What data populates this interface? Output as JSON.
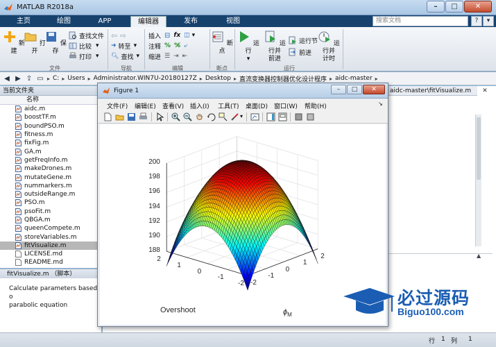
{
  "window": {
    "title": "MATLAB R2018a"
  },
  "tabs": [
    {
      "label": "主页"
    },
    {
      "label": "绘图"
    },
    {
      "label": "APP"
    },
    {
      "label": "编辑器"
    },
    {
      "label": "发布"
    },
    {
      "label": "视图"
    }
  ],
  "search": {
    "placeholder": "搜索文档"
  },
  "ribbon": {
    "file": {
      "new": "新建",
      "open": "打开",
      "save": "保存",
      "find_files": "查找文件",
      "compare": "比较",
      "print": "打印",
      "group": "文件"
    },
    "navigate": {
      "goto": "转至",
      "find": "查找",
      "group": "导航"
    },
    "edit": {
      "insert": "插入",
      "comment": "注释",
      "indent": "缩进",
      "fx": "fx",
      "group": "编辑"
    },
    "breakpoints": {
      "label": "断点",
      "group": "断点"
    },
    "run": {
      "run": "运行",
      "run_advance_1": "运行并",
      "run_advance_2": "前进",
      "run_section": "运行节",
      "advance": "前进",
      "run_time_1": "运行并",
      "run_time_2": "计时",
      "group": "运行"
    }
  },
  "addressbar": {
    "crumbs": [
      "C:",
      "Users",
      "Administrator.WIN7U-20180127Z",
      "Desktop",
      "直流变换器控制器优化设计程序",
      "aidc-master"
    ]
  },
  "folder_panel": {
    "title": "当前文件夹",
    "column": "名称",
    "files": [
      {
        "name": "aidc.m"
      },
      {
        "name": "boostTF.m"
      },
      {
        "name": "boundPSO.m"
      },
      {
        "name": "fitness.m"
      },
      {
        "name": "fixFig.m"
      },
      {
        "name": "GA.m"
      },
      {
        "name": "getFreqInfo.m"
      },
      {
        "name": "makeDrones.m"
      },
      {
        "name": "mutateGene.m"
      },
      {
        "name": "nummarkers.m"
      },
      {
        "name": "outsideRange.m"
      },
      {
        "name": "PSO.m"
      },
      {
        "name": "psoFit.m"
      },
      {
        "name": "QBGA.m"
      },
      {
        "name": "queenCompete.m"
      },
      {
        "name": "storeVariables.m"
      },
      {
        "name": "fitVisualize.m"
      },
      {
        "name": "LICENSE.md"
      },
      {
        "name": "README.md"
      }
    ],
    "selected_index": 16
  },
  "details": {
    "header": "fitVisualize.m （脚本）",
    "line1": "Calculate parameters based o",
    "line2": "parabolic equation"
  },
  "editor": {
    "tab": "aidc-master\\fitVisualize.m"
  },
  "statusbar": {
    "row_label": "行",
    "row": "1",
    "col_label": "列",
    "col": "1"
  },
  "figure": {
    "title": "Figure 1",
    "menus": [
      "文件(F)",
      "编辑(E)",
      "查看(V)",
      "插入(I)",
      "工具(T)",
      "桌面(D)",
      "窗口(W)",
      "帮助(H)"
    ],
    "ztick_labels": [
      "188",
      "190",
      "192",
      "194",
      "196",
      "198",
      "200"
    ],
    "xtick_labels": [
      "2",
      "1",
      "0",
      "-1",
      "-2"
    ],
    "ytick_labels": [
      "-2",
      "-1",
      "0",
      "1",
      "2"
    ],
    "xlabel": "Overshoot",
    "ylabel_main": "ϕ",
    "ylabel_sub": "M"
  },
  "chart_data": {
    "type": "surface",
    "colormap": "jet",
    "x_range": [
      -2,
      2
    ],
    "y_range": [
      -2,
      2
    ],
    "zlim": [
      188,
      200
    ],
    "peak": 200,
    "corner_low": 186
  },
  "watermark": {
    "title": "必过源码",
    "subtitle": "Biguo100.com"
  }
}
